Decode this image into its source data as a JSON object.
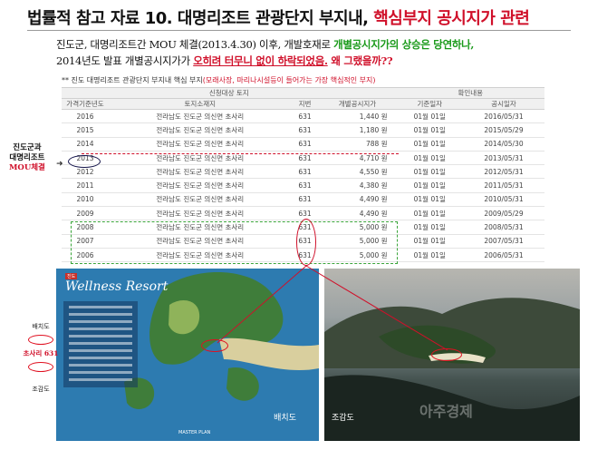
{
  "title": {
    "prefix": "법률적 참고 자료 10.  대명리조트 관광단지 부지내, ",
    "highlight": "핵심부지 공시지가 관련"
  },
  "intro": {
    "line1_plain": "진도군, 대명리조트간 MOU 체결(2013.4.30) 이후, 개발호재로 ",
    "line1_green": "개별공시지가의 상승은 당연하나,",
    "line2_plain": "2014년도 발표 개별공시지가가 ",
    "line2_red_underline": "오히려 터무니 없이 하락되었음.",
    "line2_question": "  왜 그랬을까??"
  },
  "note": {
    "plain": "** 진도 대명리조트 관광단지 부지내 핵심 부지",
    "red": "(모래사장, 마리나시설등이 들어가는 가장 핵심적인 부지)"
  },
  "table": {
    "group_headers": [
      "신청대상 토지",
      "확인내용"
    ],
    "columns": [
      "가격기준년도",
      "토지소재지",
      "지번",
      "개별공시지가",
      "기준일자",
      "공시일자"
    ],
    "rows": [
      [
        "2016",
        "전라남도 진도군 의신면 초사리",
        "631",
        "1,440 원",
        "01월 01일",
        "2016/05/31"
      ],
      [
        "2015",
        "전라남도 진도군 의신면 초사리",
        "631",
        "1,180 원",
        "01월 01일",
        "2015/05/29"
      ],
      [
        "2014",
        "전라남도 진도군 의신면 초사리",
        "631",
        "788 원",
        "01월 01일",
        "2014/05/30"
      ],
      [
        "2013",
        "전라남도 진도군 의신면 초사리",
        "631",
        "4,710 원",
        "01월 01일",
        "2013/05/31"
      ],
      [
        "2012",
        "전라남도 진도군 의신면 초사리",
        "631",
        "4,550 원",
        "01월 01일",
        "2012/05/31"
      ],
      [
        "2011",
        "전라남도 진도군 의신면 초사리",
        "631",
        "4,380 원",
        "01월 01일",
        "2011/05/31"
      ],
      [
        "2010",
        "전라남도 진도군 의신면 초사리",
        "631",
        "4,490 원",
        "01월 01일",
        "2010/05/31"
      ],
      [
        "2009",
        "전라남도 진도군 의신면 초사리",
        "631",
        "4,490 원",
        "01월 01일",
        "2009/05/29"
      ],
      [
        "2008",
        "전라남도 진도군 의신면 초사리",
        "631",
        "5,000 원",
        "01월 01일",
        "2008/05/31"
      ],
      [
        "2007",
        "전라남도 진도군 의신면 초사리",
        "631",
        "5,000 원",
        "01월 01일",
        "2007/05/31"
      ],
      [
        "2006",
        "전라남도 진도군 의신면 초사리",
        "631",
        "5,000 원",
        "01월 01일",
        "2006/05/31"
      ]
    ]
  },
  "side_label": {
    "line1": "진도군과",
    "line2": "대명리조트",
    "line3": "MOU체결",
    "arrow": "➜"
  },
  "map": {
    "badge": "진도",
    "title": "Wellness Resort",
    "master": "MASTER PLAN",
    "caption": "배치도"
  },
  "photo": {
    "caption": "조감도",
    "watermark": "아주경제"
  },
  "legend": {
    "top": "배치도",
    "lot": "초사리 631",
    "bottom": "조감도"
  },
  "colors": {
    "accent_red": "#d0102a",
    "accent_green": "#1a9a1a",
    "map_blue": "#2d7bb0"
  }
}
